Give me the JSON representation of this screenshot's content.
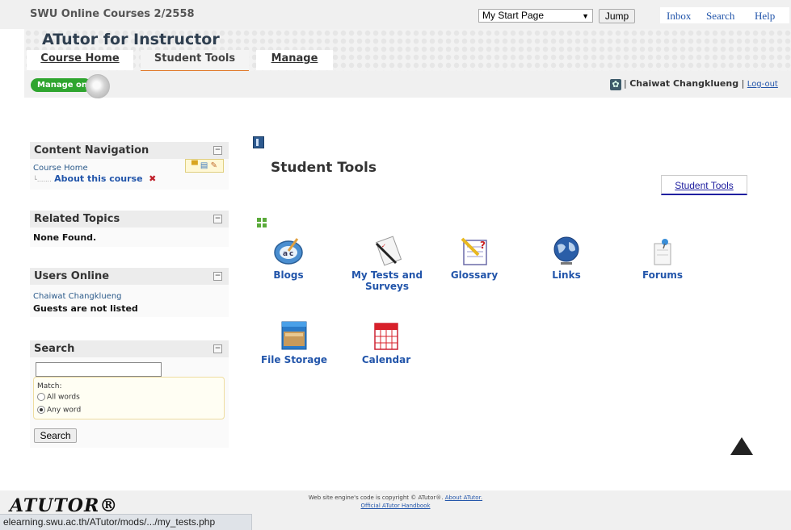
{
  "topbar": {
    "site_name": "SWU Online Courses 2/2558",
    "start_page_select": "My Start Page",
    "jump_label": "Jump",
    "links": [
      "Inbox",
      "Search",
      "Help"
    ]
  },
  "header": {
    "course_title": "ATutor for Instructor",
    "tabs": [
      "Course Home",
      "Student Tools",
      "Manage"
    ],
    "active_tab": "Student Tools"
  },
  "subbar": {
    "manage_toggle": "Manage on",
    "user_name": "Chaiwat Changklueng",
    "logout": "Log-out"
  },
  "sidebar": {
    "content_nav": {
      "title": "Content Navigation",
      "items": [
        "Course Home",
        "About this course"
      ]
    },
    "related_topics": {
      "title": "Related Topics",
      "empty": "None Found."
    },
    "users_online": {
      "title": "Users Online",
      "user": "Chaiwat Changklueng",
      "guests": "Guests are not listed"
    },
    "search": {
      "title": "Search",
      "match_label": "Match:",
      "options": [
        "All words",
        "Any word"
      ],
      "selected": "Any word",
      "button": "Search"
    }
  },
  "main": {
    "title": "Student Tools",
    "subtab": "Student Tools",
    "tools": [
      {
        "label": "Blogs",
        "icon": "blogs-icon"
      },
      {
        "label": "My Tests and Surveys",
        "icon": "tests-icon"
      },
      {
        "label": "Glossary",
        "icon": "glossary-icon"
      },
      {
        "label": "Links",
        "icon": "globe-icon"
      },
      {
        "label": "Forums",
        "icon": "forums-icon"
      },
      {
        "label": "File Storage",
        "icon": "file-storage-icon"
      },
      {
        "label": "Calendar",
        "icon": "calendar-icon"
      }
    ]
  },
  "footer": {
    "logo": "ATUTOR®",
    "copyright": "Web site engine's code is copyright © ATutor®.",
    "about_link": "About ATutor.",
    "handbook_link": "Official ATutor Handbook"
  },
  "statusbar": {
    "url": "elearning.swu.ac.th/ATutor/mods/.../my_tests.php"
  }
}
